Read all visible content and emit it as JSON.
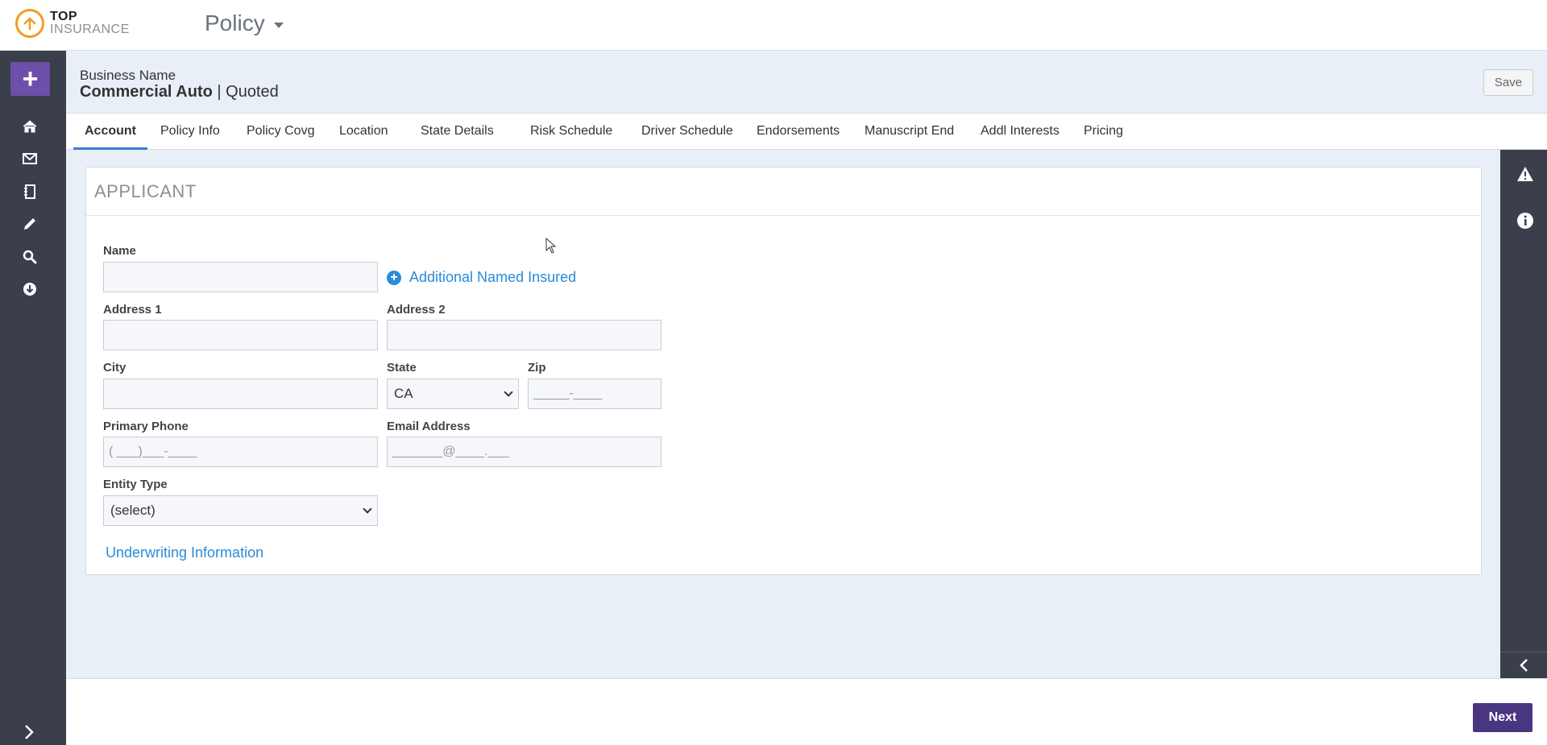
{
  "app": {
    "logo_top": "TOP",
    "logo_bottom": "INSURANCE",
    "module": "Policy"
  },
  "policy": {
    "business_name": "Business Name",
    "product": "Commercial Auto",
    "separator": "|",
    "status": "Quoted",
    "save_label": "Save"
  },
  "tabs": [
    {
      "label": "Account",
      "active": true
    },
    {
      "label": "Policy Info"
    },
    {
      "label": "Policy Covg"
    },
    {
      "label": "Location"
    },
    {
      "label": "State Details"
    },
    {
      "label": "Risk Schedule"
    },
    {
      "label": "Driver Schedule"
    },
    {
      "label": "Endorsements"
    },
    {
      "label": "Manuscript End"
    },
    {
      "label": "Addl Interests"
    },
    {
      "label": "Pricing"
    }
  ],
  "applicant": {
    "title": "APPLICANT",
    "name_label": "Name",
    "additional_named_insured": "Additional Named Insured",
    "address1_label": "Address 1",
    "address2_label": "Address 2",
    "city_label": "City",
    "state_label": "State",
    "state_value": "CA",
    "zip_label": "Zip",
    "zip_placeholder": "_____-____",
    "phone_label": "Primary Phone",
    "phone_placeholder": "( ___)___-____",
    "email_label": "Email Address",
    "email_placeholder": "_______@____.___",
    "entity_label": "Entity Type",
    "entity_value": "(select)",
    "underwriting_link": "Underwriting Information"
  },
  "footer": {
    "next_label": "Next"
  },
  "icons": {
    "nav": [
      "home-icon",
      "mail-icon",
      "notebook-icon",
      "pencil-icon",
      "search-icon",
      "download-icon"
    ],
    "right_rail": [
      "warning-icon",
      "info-icon"
    ]
  },
  "colors": {
    "accent_purple": "#6c4fa8",
    "next_purple": "#4a3580",
    "link_blue": "#2a8bd8",
    "nav_dark": "#3b3f4b",
    "logo_orange": "#f39c1f"
  }
}
